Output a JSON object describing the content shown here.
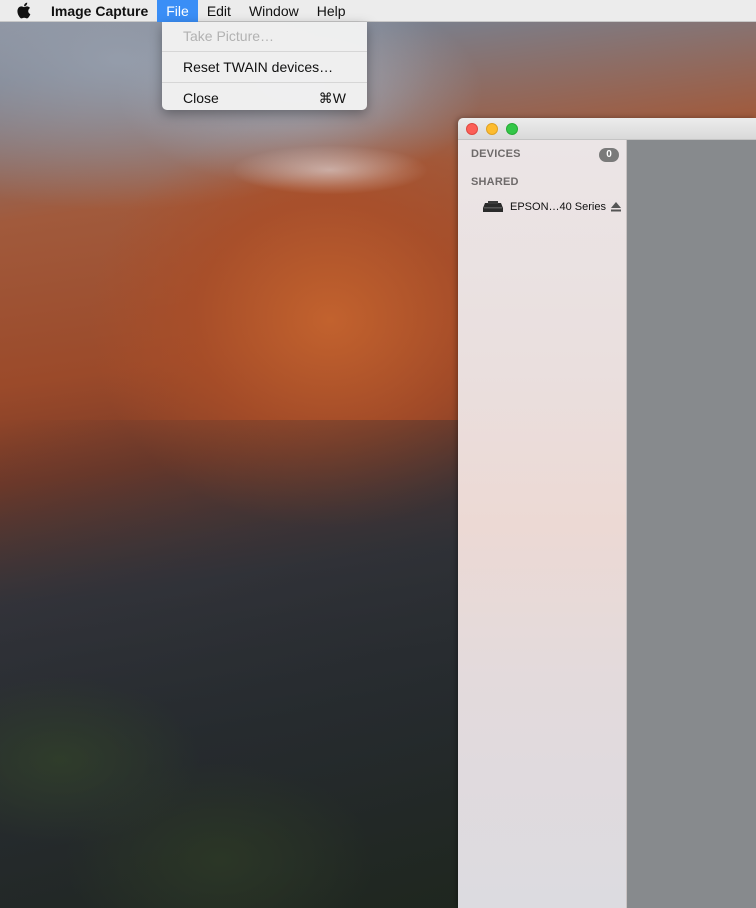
{
  "menubar": {
    "apple_icon": "apple-logo-icon",
    "app_name": "Image Capture",
    "menus": [
      "File",
      "Edit",
      "Window",
      "Help"
    ],
    "active_menu": "File"
  },
  "file_menu": {
    "items": [
      {
        "label": "Take Picture…",
        "shortcut": "",
        "enabled": false
      },
      {
        "label": "Reset TWAIN devices…",
        "shortcut": "",
        "enabled": true
      },
      {
        "label": "Close",
        "shortcut": "⌘W",
        "enabled": true
      }
    ]
  },
  "window": {
    "traffic_lights": [
      "close",
      "minimize",
      "zoom"
    ],
    "sidebar": {
      "devices_header": "DEVICES",
      "devices_count": "0",
      "shared_header": "SHARED",
      "shared_devices": [
        {
          "name": "EPSON…40 Series",
          "icon": "printer-icon",
          "action_icon": "eject-icon"
        }
      ]
    }
  },
  "colors": {
    "menu_highlight": "#3a8ef6",
    "close": "#fc5f57",
    "minimize": "#fdbc2e",
    "zoom": "#33c748",
    "content_bg": "#878a8d"
  }
}
